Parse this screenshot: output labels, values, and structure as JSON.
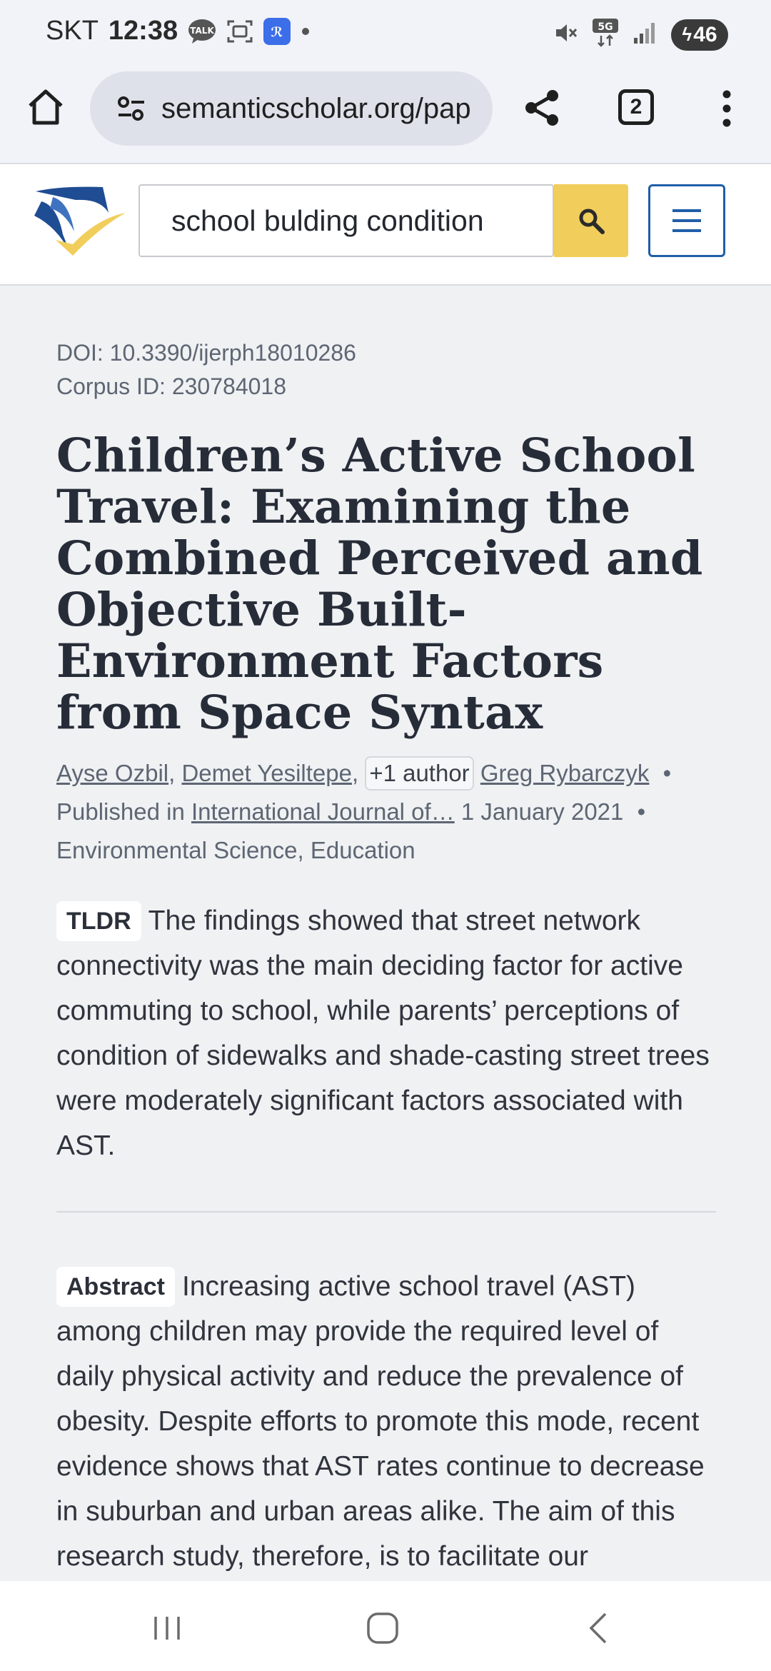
{
  "status_bar": {
    "carrier": "SKT",
    "time": "12:38",
    "battery": "46"
  },
  "browser": {
    "url": "semanticscholar.org/pap",
    "tab_count": "2"
  },
  "site": {
    "search_value": "school bulding condition"
  },
  "paper": {
    "doi": "DOI: 10.3390/ijerph18010286",
    "corpus_id": "Corpus ID: 230784018",
    "title": "Children’s Active School Travel: Examining the Combined Perceived and Objective Built-Environment Factors from Space Syntax",
    "authors": [
      "Ayse Ozbil",
      "Demet Yesiltepe"
    ],
    "more_authors": "+1 author",
    "last_author": "Greg Rybarczyk",
    "published_label": "Published in",
    "journal": "International Journal of…",
    "date": "1 January 2021",
    "fields": "Environmental Science, Education",
    "tldr_label": "TLDR",
    "tldr_text": "The findings showed that street network connectivity was the main deciding factor for active commuting to school, while parents’ perceptions of condition of sidewalks and shade-casting street trees were moderately significant factors associated with AST.",
    "abstract_label": "Abstract",
    "abstract_text": "Increasing active school travel (AST) among children may provide the required level of daily physical activity and reduce the prevalence of obesity. Despite efforts to promote this mode, recent evidence shows that AST rates continue to decrease in suburban and urban areas alike. The aim of this research study, therefore, is to facilitate our understanding of how objective and"
  },
  "colors": {
    "search_button": "#f1ce5b",
    "menu_border": "#1f5ea8",
    "page_background": "#f0f1f3"
  },
  "icons": [
    "talk-icon",
    "screenshot-icon",
    "app-icon",
    "mute-icon",
    "5g-icon",
    "signal-icon",
    "home-icon",
    "site-settings-icon",
    "share-icon",
    "tabs-icon",
    "more-vert-icon",
    "search-icon",
    "hamburger-icon",
    "recents-icon",
    "home-nav-icon",
    "back-icon"
  ]
}
